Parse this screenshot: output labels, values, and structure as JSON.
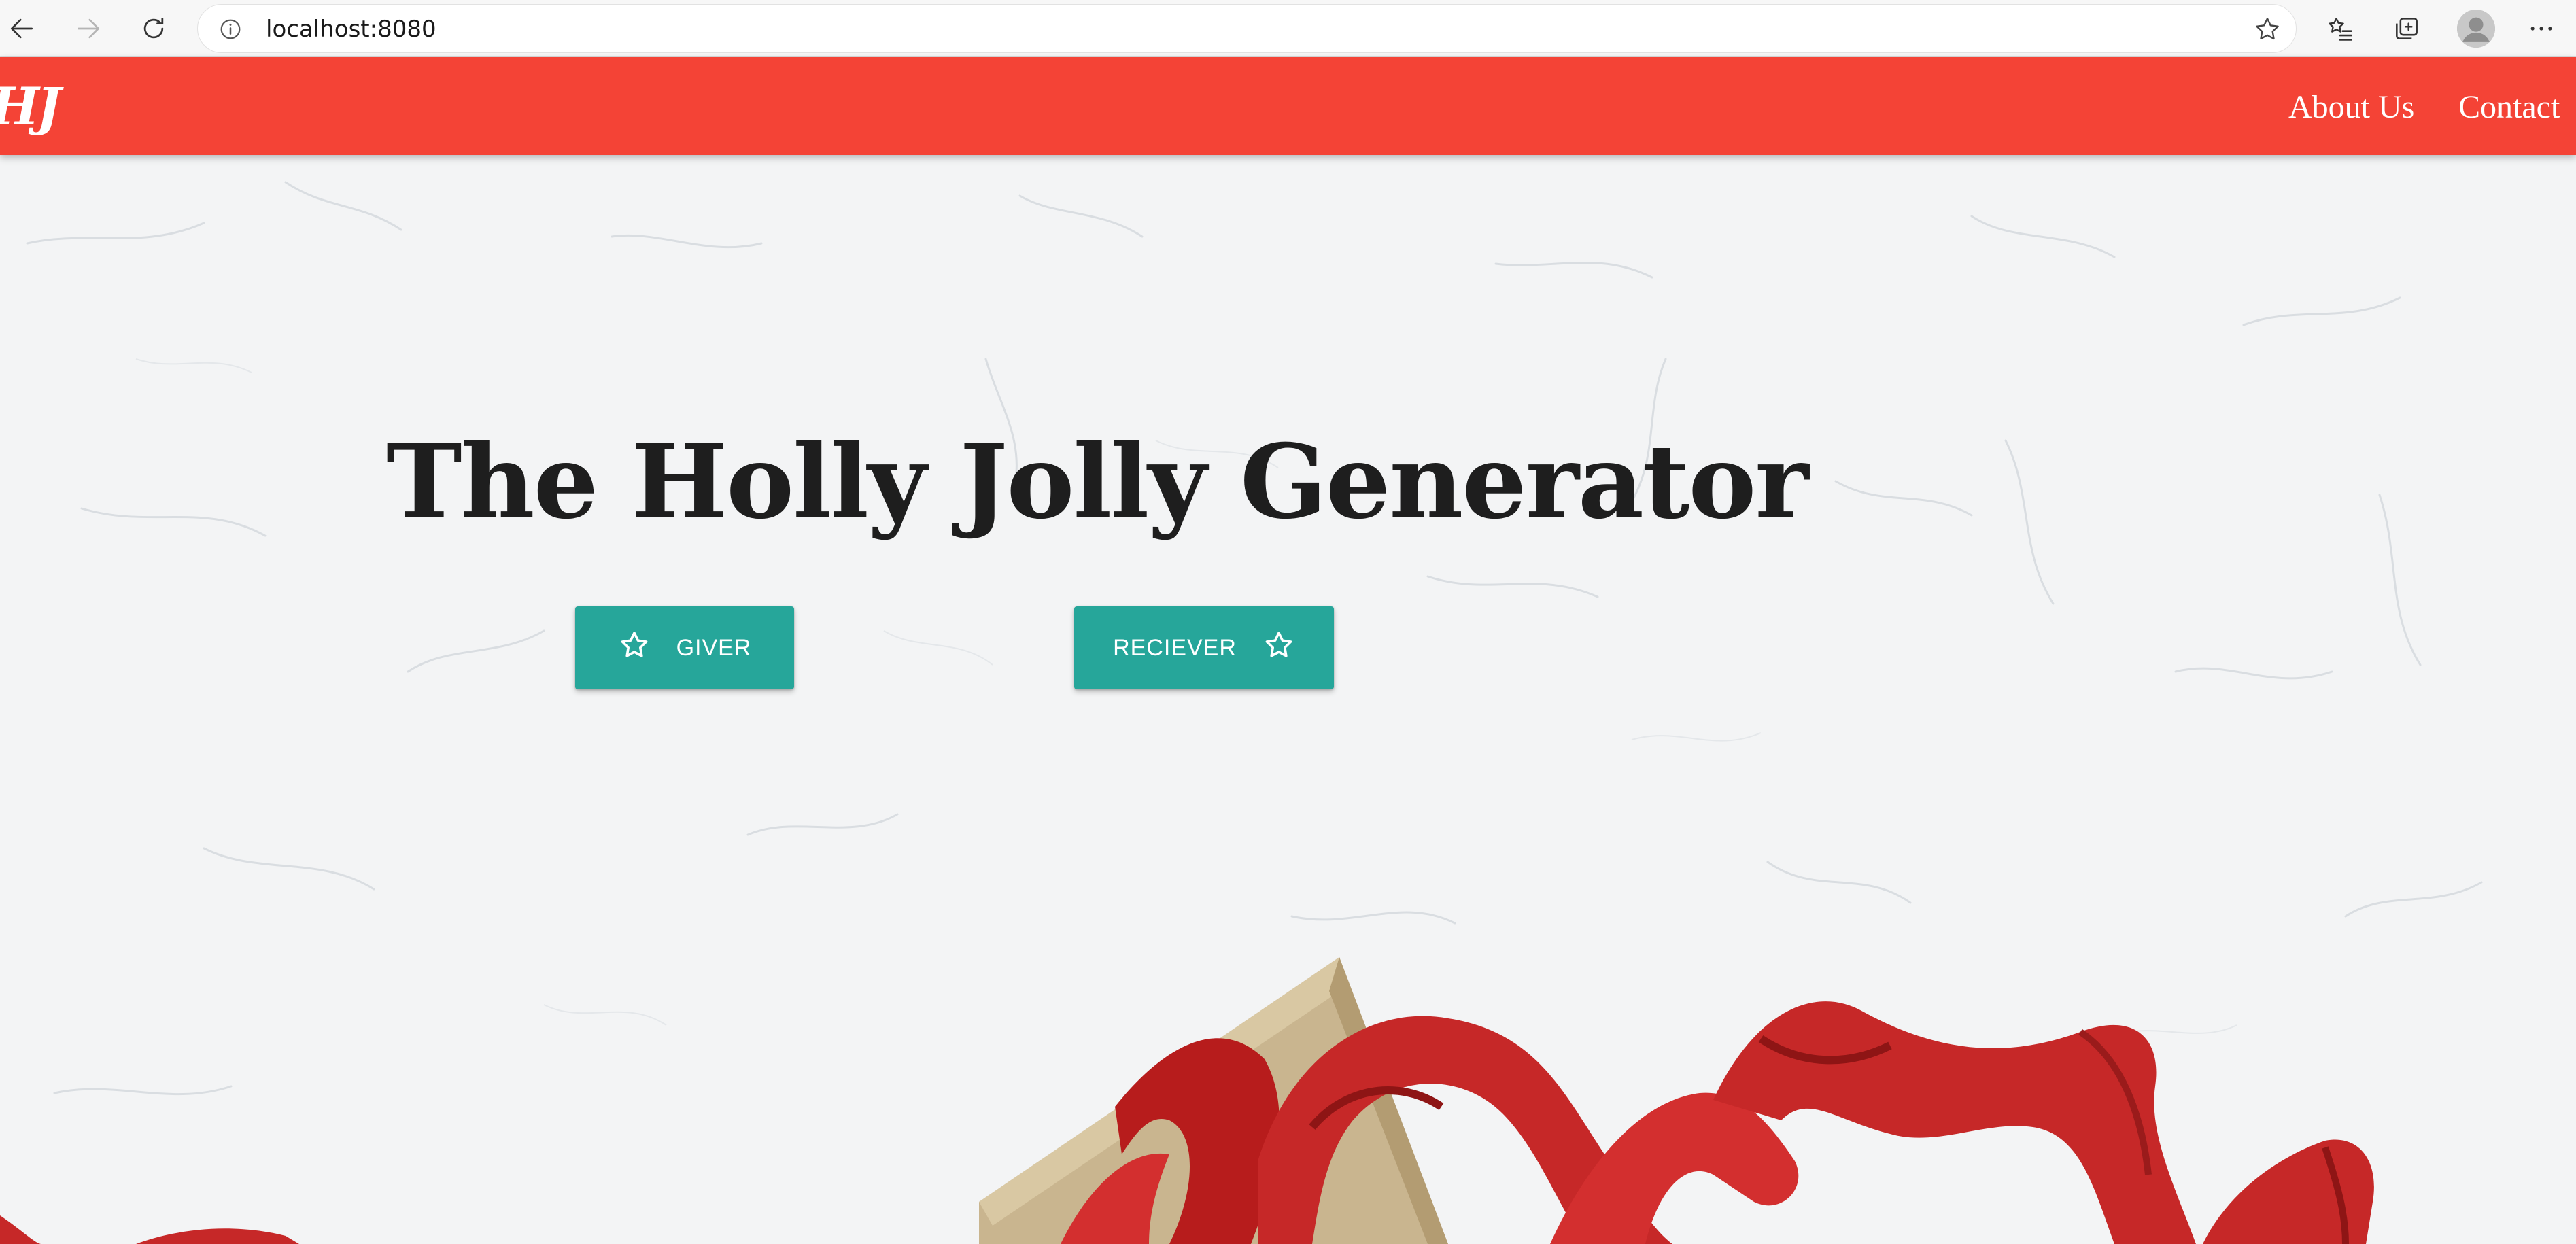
{
  "browser": {
    "url": "localhost:8080",
    "icons": [
      "back-arrow-icon",
      "forward-arrow-icon",
      "refresh-icon",
      "info-icon",
      "favorite-star-icon",
      "favorites-list-icon",
      "collections-icon",
      "profile-avatar",
      "more-options-icon"
    ]
  },
  "navbar": {
    "logo": "HJ",
    "links": [
      "About Us",
      "Contact"
    ],
    "color": "#f44336"
  },
  "hero": {
    "title": "The Holly Jolly Generator",
    "buttons": {
      "giver": "GIVER",
      "reciever": "RECIEVER"
    },
    "button_icon": "star-outline-icon",
    "button_color": "#26a69a"
  }
}
